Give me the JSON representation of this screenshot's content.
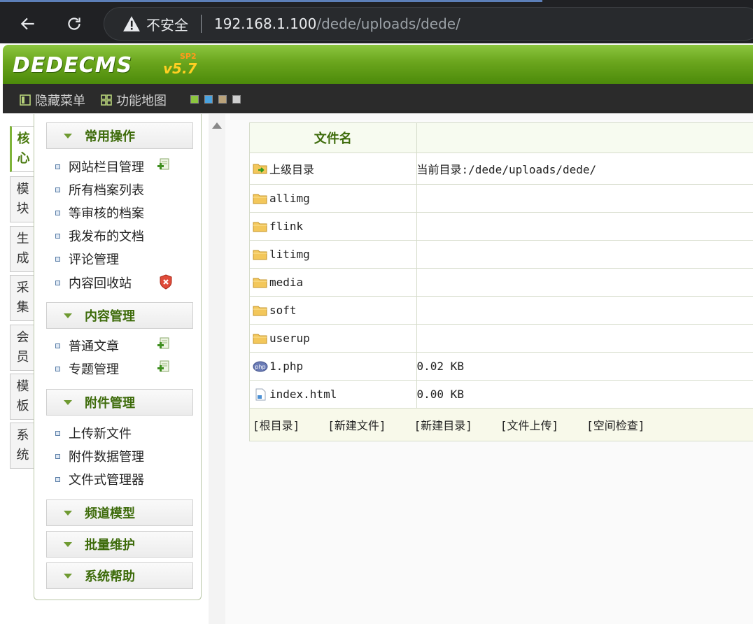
{
  "browser": {
    "insecure_label": "不安全",
    "url_host": "192.168.1.100",
    "url_path": "/dede/uploads/dede/"
  },
  "header": {
    "logo_text": "DEDECMS",
    "logo_version": "v5.7",
    "logo_sp": "SP2"
  },
  "toolbar": {
    "hide_menu": "隐藏菜单",
    "site_map": "功能地图",
    "swatches": [
      "#8cc63f",
      "#4aa3df",
      "#b9a27a",
      "#cfcfcf"
    ]
  },
  "left_tabs": [
    {
      "l1": "核",
      "l2": "心"
    },
    {
      "l1": "模",
      "l2": "块"
    },
    {
      "l1": "生",
      "l2": "成"
    },
    {
      "l1": "采",
      "l2": "集"
    },
    {
      "l1": "会",
      "l2": "员"
    },
    {
      "l1": "模",
      "l2": "板"
    },
    {
      "l1": "系",
      "l2": "统"
    }
  ],
  "menu": {
    "common": {
      "title": "常用操作",
      "items": [
        "网站栏目管理",
        "所有档案列表",
        "等审核的档案",
        "我发布的文档",
        "评论管理",
        "内容回收站"
      ]
    },
    "content": {
      "title": "内容管理",
      "items": [
        "普通文章",
        "专题管理"
      ]
    },
    "attach": {
      "title": "附件管理",
      "items": [
        "上传新文件",
        "附件数据管理",
        "文件式管理器"
      ]
    },
    "channel": {
      "title": "频道模型"
    },
    "batch": {
      "title": "批量维护"
    },
    "help": {
      "title": "系统帮助"
    }
  },
  "files": {
    "header_name": "文件名",
    "parent_label": "上级目录",
    "current_dir": "当前目录:/dede/uploads/dede/",
    "rows": [
      {
        "name": "allimg",
        "size": ""
      },
      {
        "name": "flink",
        "size": ""
      },
      {
        "name": "litimg",
        "size": ""
      },
      {
        "name": "media",
        "size": ""
      },
      {
        "name": "soft",
        "size": ""
      },
      {
        "name": "userup",
        "size": ""
      },
      {
        "name": "1.php",
        "size": "0.02 KB"
      },
      {
        "name": "index.html",
        "size": "0.00 KB"
      }
    ],
    "actions": [
      "[根目录]",
      "[新建文件]",
      "[新建目录]",
      "[文件上传]",
      "[空间检查]"
    ]
  }
}
